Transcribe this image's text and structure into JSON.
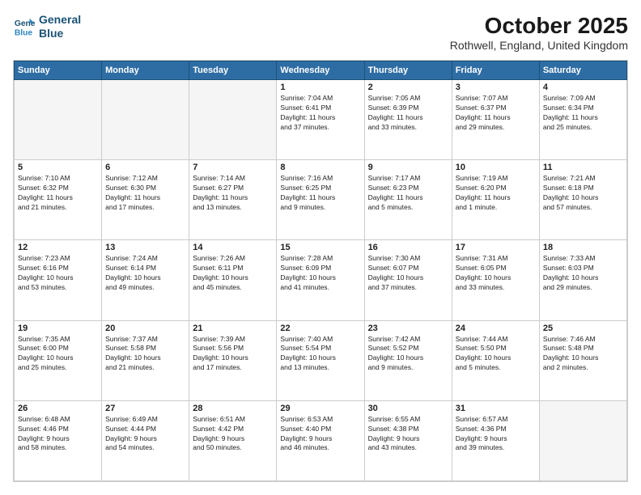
{
  "logo": {
    "line1": "General",
    "line2": "Blue"
  },
  "title": "October 2025",
  "subtitle": "Rothwell, England, United Kingdom",
  "days_of_week": [
    "Sunday",
    "Monday",
    "Tuesday",
    "Wednesday",
    "Thursday",
    "Friday",
    "Saturday"
  ],
  "weeks": [
    [
      {
        "day": "",
        "info": ""
      },
      {
        "day": "",
        "info": ""
      },
      {
        "day": "",
        "info": ""
      },
      {
        "day": "1",
        "info": "Sunrise: 7:04 AM\nSunset: 6:41 PM\nDaylight: 11 hours\nand 37 minutes."
      },
      {
        "day": "2",
        "info": "Sunrise: 7:05 AM\nSunset: 6:39 PM\nDaylight: 11 hours\nand 33 minutes."
      },
      {
        "day": "3",
        "info": "Sunrise: 7:07 AM\nSunset: 6:37 PM\nDaylight: 11 hours\nand 29 minutes."
      },
      {
        "day": "4",
        "info": "Sunrise: 7:09 AM\nSunset: 6:34 PM\nDaylight: 11 hours\nand 25 minutes."
      }
    ],
    [
      {
        "day": "5",
        "info": "Sunrise: 7:10 AM\nSunset: 6:32 PM\nDaylight: 11 hours\nand 21 minutes."
      },
      {
        "day": "6",
        "info": "Sunrise: 7:12 AM\nSunset: 6:30 PM\nDaylight: 11 hours\nand 17 minutes."
      },
      {
        "day": "7",
        "info": "Sunrise: 7:14 AM\nSunset: 6:27 PM\nDaylight: 11 hours\nand 13 minutes."
      },
      {
        "day": "8",
        "info": "Sunrise: 7:16 AM\nSunset: 6:25 PM\nDaylight: 11 hours\nand 9 minutes."
      },
      {
        "day": "9",
        "info": "Sunrise: 7:17 AM\nSunset: 6:23 PM\nDaylight: 11 hours\nand 5 minutes."
      },
      {
        "day": "10",
        "info": "Sunrise: 7:19 AM\nSunset: 6:20 PM\nDaylight: 11 hours\nand 1 minute."
      },
      {
        "day": "11",
        "info": "Sunrise: 7:21 AM\nSunset: 6:18 PM\nDaylight: 10 hours\nand 57 minutes."
      }
    ],
    [
      {
        "day": "12",
        "info": "Sunrise: 7:23 AM\nSunset: 6:16 PM\nDaylight: 10 hours\nand 53 minutes."
      },
      {
        "day": "13",
        "info": "Sunrise: 7:24 AM\nSunset: 6:14 PM\nDaylight: 10 hours\nand 49 minutes."
      },
      {
        "day": "14",
        "info": "Sunrise: 7:26 AM\nSunset: 6:11 PM\nDaylight: 10 hours\nand 45 minutes."
      },
      {
        "day": "15",
        "info": "Sunrise: 7:28 AM\nSunset: 6:09 PM\nDaylight: 10 hours\nand 41 minutes."
      },
      {
        "day": "16",
        "info": "Sunrise: 7:30 AM\nSunset: 6:07 PM\nDaylight: 10 hours\nand 37 minutes."
      },
      {
        "day": "17",
        "info": "Sunrise: 7:31 AM\nSunset: 6:05 PM\nDaylight: 10 hours\nand 33 minutes."
      },
      {
        "day": "18",
        "info": "Sunrise: 7:33 AM\nSunset: 6:03 PM\nDaylight: 10 hours\nand 29 minutes."
      }
    ],
    [
      {
        "day": "19",
        "info": "Sunrise: 7:35 AM\nSunset: 6:00 PM\nDaylight: 10 hours\nand 25 minutes."
      },
      {
        "day": "20",
        "info": "Sunrise: 7:37 AM\nSunset: 5:58 PM\nDaylight: 10 hours\nand 21 minutes."
      },
      {
        "day": "21",
        "info": "Sunrise: 7:39 AM\nSunset: 5:56 PM\nDaylight: 10 hours\nand 17 minutes."
      },
      {
        "day": "22",
        "info": "Sunrise: 7:40 AM\nSunset: 5:54 PM\nDaylight: 10 hours\nand 13 minutes."
      },
      {
        "day": "23",
        "info": "Sunrise: 7:42 AM\nSunset: 5:52 PM\nDaylight: 10 hours\nand 9 minutes."
      },
      {
        "day": "24",
        "info": "Sunrise: 7:44 AM\nSunset: 5:50 PM\nDaylight: 10 hours\nand 5 minutes."
      },
      {
        "day": "25",
        "info": "Sunrise: 7:46 AM\nSunset: 5:48 PM\nDaylight: 10 hours\nand 2 minutes."
      }
    ],
    [
      {
        "day": "26",
        "info": "Sunrise: 6:48 AM\nSunset: 4:46 PM\nDaylight: 9 hours\nand 58 minutes."
      },
      {
        "day": "27",
        "info": "Sunrise: 6:49 AM\nSunset: 4:44 PM\nDaylight: 9 hours\nand 54 minutes."
      },
      {
        "day": "28",
        "info": "Sunrise: 6:51 AM\nSunset: 4:42 PM\nDaylight: 9 hours\nand 50 minutes."
      },
      {
        "day": "29",
        "info": "Sunrise: 6:53 AM\nSunset: 4:40 PM\nDaylight: 9 hours\nand 46 minutes."
      },
      {
        "day": "30",
        "info": "Sunrise: 6:55 AM\nSunset: 4:38 PM\nDaylight: 9 hours\nand 43 minutes."
      },
      {
        "day": "31",
        "info": "Sunrise: 6:57 AM\nSunset: 4:36 PM\nDaylight: 9 hours\nand 39 minutes."
      },
      {
        "day": "",
        "info": ""
      }
    ]
  ]
}
